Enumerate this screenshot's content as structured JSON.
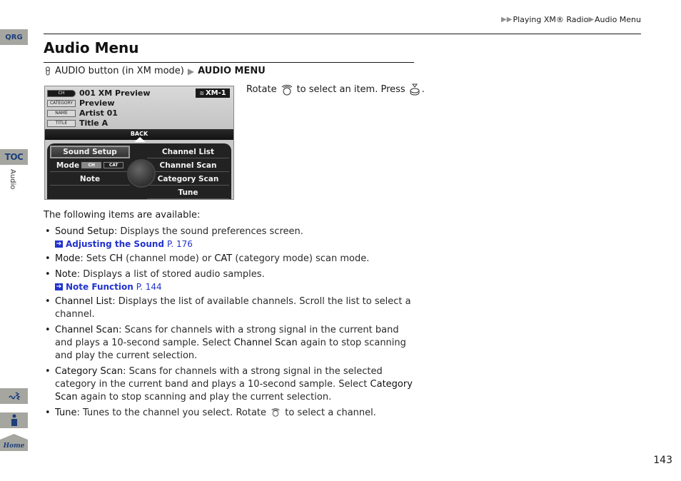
{
  "side_tabs": {
    "qrg": "QRG",
    "toc": "TOC",
    "section_label": "Audio",
    "voice_icon": "voice-command-icon",
    "info_icon": "info-icon",
    "home": "Home"
  },
  "breadcrumb": {
    "items": [
      "Playing XM® Radio",
      "Audio Menu"
    ]
  },
  "page": {
    "title": "Audio Menu",
    "path_prefix": "AUDIO button (in XM mode)",
    "path_target": "AUDIO MENU",
    "instruction_rotate": "Rotate",
    "instruction_middle": "to select an item. Press",
    "instruction_end": ".",
    "page_number": "143"
  },
  "screen": {
    "info_rows": [
      {
        "tag": "CH",
        "value": "001 XM Preview"
      },
      {
        "tag": "CATEGORY",
        "value": "Preview"
      },
      {
        "tag": "NAME",
        "value": "Artist 01"
      },
      {
        "tag": "TITLE",
        "value": "Title A"
      }
    ],
    "badge": "XM-1",
    "back": "BACK",
    "left_menu": [
      "Sound Setup",
      "Mode",
      "Note"
    ],
    "mode_options": [
      "CH",
      "CAT"
    ],
    "right_menu": [
      "Channel List",
      "Channel Scan",
      "Category Scan",
      "Tune"
    ]
  },
  "body": {
    "intro": "The following items are available:",
    "items": [
      {
        "term": "Sound Setup",
        "text": ": Displays the sound preferences screen.",
        "xref": {
          "label": "Adjusting the Sound",
          "page": "P. 176"
        }
      },
      {
        "term": "Mode",
        "text_a": ": Sets ",
        "b1": "CH",
        "text_b": " (channel mode) or ",
        "b2": "CAT",
        "text_c": " (category mode) scan mode."
      },
      {
        "term": "Note",
        "text": ": Displays a list of stored audio samples.",
        "xref": {
          "label": "Note Function",
          "page": "P. 144"
        }
      },
      {
        "term": "Channel List",
        "text": ": Displays the list of available channels. Scroll the list to select a channel."
      },
      {
        "term": "Channel Scan",
        "text_a": ": Scans for channels with a strong signal in the current band and plays a 10-second sample. Select ",
        "b1": "Channel Scan",
        "text_b": " again to stop scanning and play the current selection."
      },
      {
        "term": "Category Scan",
        "text_a": ": Scans for channels with a strong signal in the selected category in the current band and plays a 10-second sample. Select ",
        "b1": "Category Scan",
        "text_b": " again to stop scanning and play the current selection."
      },
      {
        "term": "Tune",
        "text_a": ": Tunes to the channel you select. Rotate ",
        "text_b": " to select a channel."
      }
    ]
  },
  "colors": {
    "tab_bg": "#a6a6a1",
    "tab_text": "#1c3f7a",
    "link": "#2233cc"
  }
}
